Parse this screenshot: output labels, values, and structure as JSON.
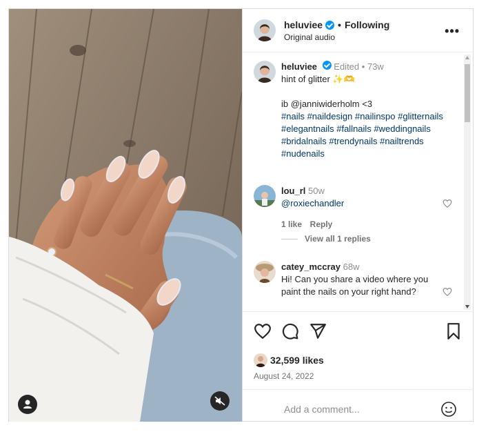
{
  "header": {
    "username": "heluviee",
    "separator": "•",
    "follow_label": "Following",
    "audio_label": "Original audio",
    "more_icon": "more-horizontal-icon"
  },
  "caption": {
    "username": "heluviee",
    "edited_label": "Edited",
    "separator": "•",
    "age": "73w",
    "line1": "hint of glitter ✨🫶",
    "line2": "ib @janniwiderholm <3",
    "hashtags": "#nails #naildesign #nailinspo #glitternails #elegantnails #fallnails #weddingnails #bridalnails #trendynails #nailtrends #nudenails"
  },
  "comments": [
    {
      "username": "lou_rl",
      "age": "50w",
      "text": "@roxiechandler",
      "likes_label": "1 like",
      "reply_label": "Reply",
      "view_replies": "View all 1 replies"
    },
    {
      "username": "catey_mccray",
      "age": "68w",
      "text": "Hi! Can you share a video where you paint the nails on your right hand?"
    }
  ],
  "footer": {
    "likes": "32,599 likes",
    "date": "August 24, 2022",
    "add_comment_placeholder": "Add a comment..."
  },
  "colors": {
    "verified": "#0095f6",
    "link": "#00376b",
    "muted": "#737373"
  }
}
